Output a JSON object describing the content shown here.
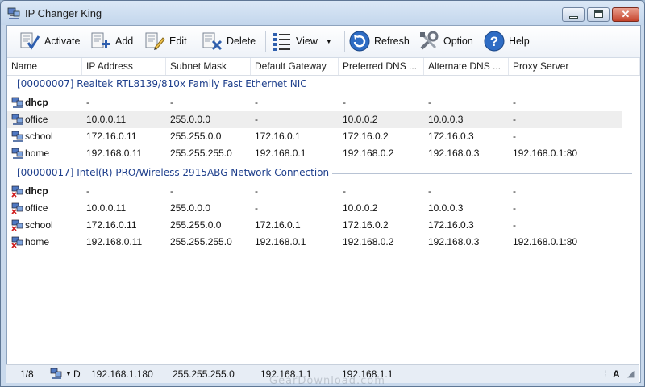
{
  "window": {
    "title": "IP Changer King"
  },
  "toolbar": {
    "activate": "Activate",
    "add": "Add",
    "edit": "Edit",
    "delete": "Delete",
    "view": "View",
    "refresh": "Refresh",
    "option": "Option",
    "help": "Help"
  },
  "columns": [
    "Name",
    "IP Address",
    "Subnet Mask",
    "Default Gateway",
    "Preferred DNS ...",
    "Alternate DNS ...",
    "Proxy Server"
  ],
  "groups": [
    {
      "label": "[00000007] Realtek RTL8139/810x Family Fast Ethernet NIC",
      "rows": [
        {
          "name": "dhcp",
          "ip": "-",
          "mask": "-",
          "gateway": "-",
          "dns1": "-",
          "dns2": "-",
          "proxy": "-"
        },
        {
          "name": "office",
          "ip": "10.0.0.11",
          "mask": "255.0.0.0",
          "gateway": "-",
          "dns1": "10.0.0.2",
          "dns2": "10.0.0.3",
          "proxy": "-"
        },
        {
          "name": "school",
          "ip": "172.16.0.11",
          "mask": "255.255.0.0",
          "gateway": "172.16.0.1",
          "dns1": "172.16.0.2",
          "dns2": "172.16.0.3",
          "proxy": "-"
        },
        {
          "name": "home",
          "ip": "192.168.0.11",
          "mask": "255.255.255.0",
          "gateway": "192.168.0.1",
          "dns1": "192.168.0.2",
          "dns2": "192.168.0.3",
          "proxy": "192.168.0.1:80"
        }
      ]
    },
    {
      "label": "[00000017] Intel(R) PRO/Wireless 2915ABG Network Connection",
      "rows": [
        {
          "name": "dhcp",
          "ip": "-",
          "mask": "-",
          "gateway": "-",
          "dns1": "-",
          "dns2": "-",
          "proxy": "-"
        },
        {
          "name": "office",
          "ip": "10.0.0.11",
          "mask": "255.0.0.0",
          "gateway": "-",
          "dns1": "10.0.0.2",
          "dns2": "10.0.0.3",
          "proxy": "-"
        },
        {
          "name": "school",
          "ip": "172.16.0.11",
          "mask": "255.255.0.0",
          "gateway": "172.16.0.1",
          "dns1": "172.16.0.2",
          "dns2": "172.16.0.3",
          "proxy": "-"
        },
        {
          "name": "home",
          "ip": "192.168.0.11",
          "mask": "255.255.255.0",
          "gateway": "192.168.0.1",
          "dns1": "192.168.0.2",
          "dns2": "192.168.0.3",
          "proxy": "192.168.0.1:80"
        }
      ]
    }
  ],
  "status": {
    "position": "1/8",
    "drive": "D",
    "ip": "192.168.1.180",
    "mask": "255.255.255.0",
    "gateway": "192.168.1.1",
    "dns": "192.168.1.1",
    "font_label": "A"
  },
  "watermark": "GearDownload.com"
}
